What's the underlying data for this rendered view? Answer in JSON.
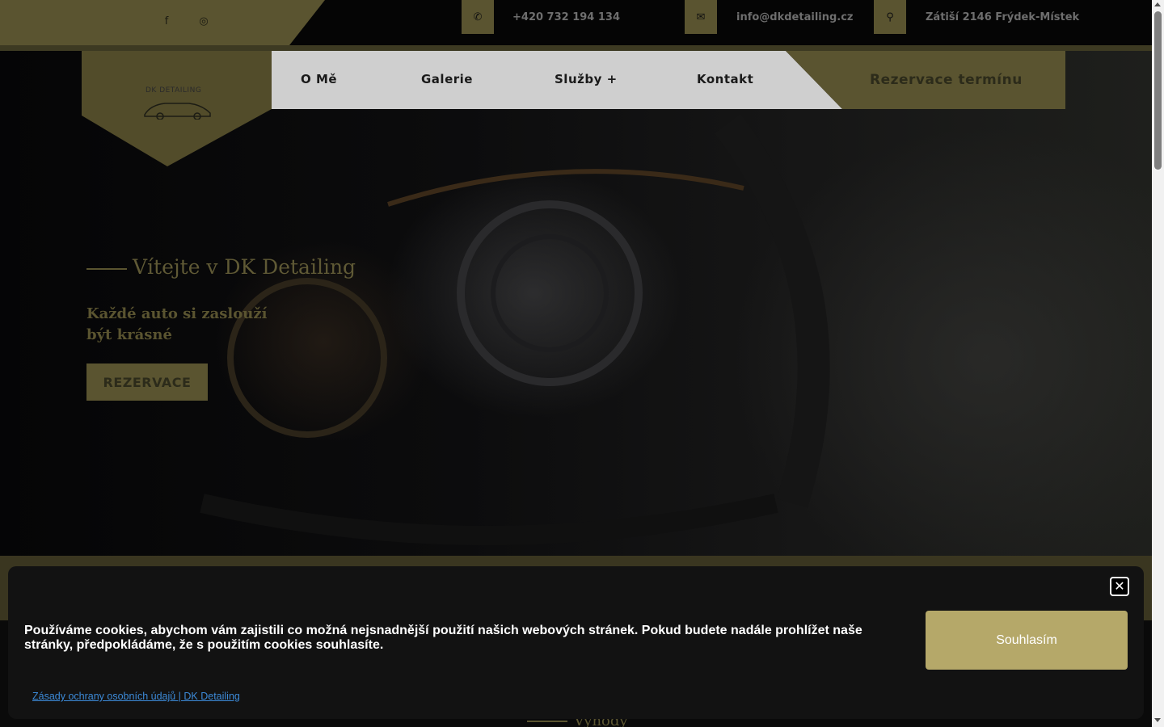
{
  "topbar": {
    "social": [
      {
        "name": "facebook-icon",
        "glyph": "f"
      },
      {
        "name": "instagram-icon",
        "glyph": "◎"
      }
    ],
    "contacts": [
      {
        "icon": "phone-icon",
        "glyph": "✆",
        "text": "+420 732 194 134"
      },
      {
        "icon": "mail-icon",
        "glyph": "✉",
        "text": "info@dkdetailing.cz"
      },
      {
        "icon": "location-pin-icon",
        "glyph": "⚲",
        "text": "Zátiší 2146 Frýdek-Místek"
      }
    ]
  },
  "logo": {
    "text": "DK DETAILING"
  },
  "nav": {
    "items": [
      "O Mě",
      "Galerie",
      "Služby +",
      "Kontakt"
    ],
    "cta": "Rezervace termínu"
  },
  "hero": {
    "title": "Vítejte v DK Detailing",
    "subtitle_line1": "Každé auto si zaslouží",
    "subtitle_line2": "být krásné",
    "button": "REZERVACE"
  },
  "section": {
    "title": "Výhody"
  },
  "cookie": {
    "text": "Používáme cookies, abychom vám zajistili co možná nejsnadnější použití našich webových stránek. Pokud budete nadále prohlížet naše stránky, předpokládáme, že s použitím cookies souhlasíte.",
    "accept": "Souhlasím",
    "policy_link": "Zásady ochrany osobních údajů | DK Detailing",
    "close_glyph": "✕"
  },
  "colors": {
    "gold": "#5a5430",
    "button_gold": "#b5a869",
    "link": "#3c8ad8",
    "banner_bg": "#121212"
  }
}
